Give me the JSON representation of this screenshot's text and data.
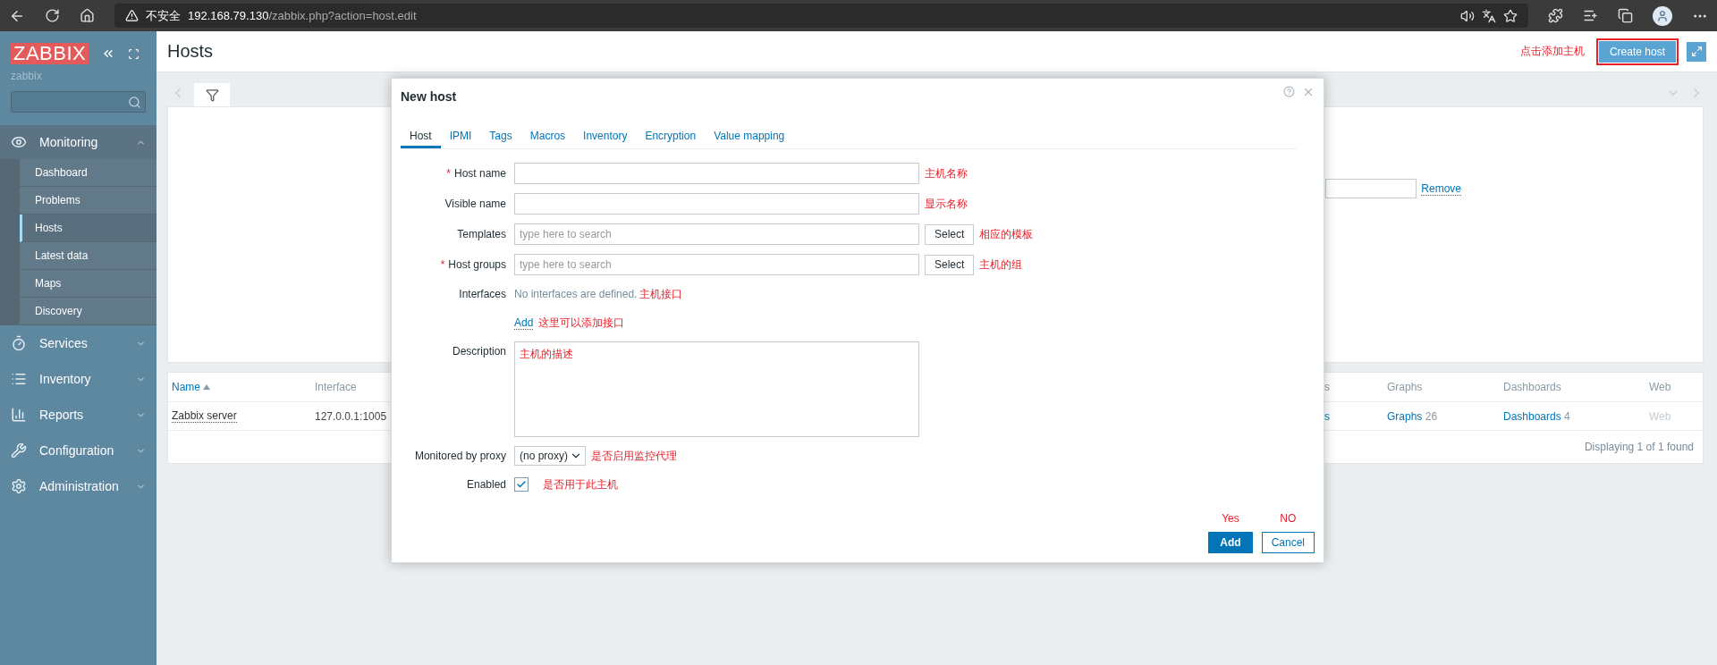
{
  "browser": {
    "security_label": "不安全",
    "url_host": "192.168.79.130",
    "url_path": "/zabbix.php?action=host.edit"
  },
  "sidebar": {
    "logo": "ZABBIX",
    "user": "zabbix",
    "menu": [
      {
        "label": "Monitoring",
        "expanded": true,
        "children": [
          {
            "label": "Dashboard",
            "selected": false
          },
          {
            "label": "Problems",
            "selected": false
          },
          {
            "label": "Hosts",
            "selected": true
          },
          {
            "label": "Latest data",
            "selected": false
          },
          {
            "label": "Maps",
            "selected": false
          },
          {
            "label": "Discovery",
            "selected": false
          }
        ]
      },
      {
        "label": "Services",
        "expanded": false
      },
      {
        "label": "Inventory",
        "expanded": false
      },
      {
        "label": "Reports",
        "expanded": false
      },
      {
        "label": "Configuration",
        "expanded": false
      },
      {
        "label": "Administration",
        "expanded": false
      }
    ]
  },
  "page": {
    "title": "Hosts",
    "annotation": "点击添加主机",
    "create_button": {
      "label": "Create host",
      "highlighted": true
    }
  },
  "filter": {
    "remove_link": "Remove"
  },
  "table": {
    "columns": [
      {
        "label": "Name",
        "sorted": true
      },
      {
        "label": "Interface",
        "sorted": false
      },
      {
        "label": "s",
        "sorted": false
      },
      {
        "label": "Graphs",
        "sorted": false
      },
      {
        "label": "Dashboards",
        "sorted": false
      },
      {
        "label": "Web",
        "sorted": false
      }
    ],
    "rows": [
      {
        "cells": [
          {
            "kind": "host",
            "text": "Zabbix server"
          },
          {
            "kind": "text",
            "text": "127.0.0.1:1005"
          },
          {
            "kind": "link",
            "text": "s"
          },
          {
            "kind": "link",
            "text": "Graphs",
            "count": "26"
          },
          {
            "kind": "link",
            "text": "Dashboards",
            "count": "4"
          },
          {
            "kind": "disabled",
            "text": "Web"
          }
        ]
      }
    ],
    "footer": "Displaying 1 of 1 found"
  },
  "dialog": {
    "title": "New host",
    "required_mark": "*",
    "tabs": [
      {
        "label": "Host",
        "selected": true
      },
      {
        "label": "IPMI",
        "selected": false
      },
      {
        "label": "Tags",
        "selected": false
      },
      {
        "label": "Macros",
        "selected": false
      },
      {
        "label": "Inventory",
        "selected": false
      },
      {
        "label": "Encryption",
        "selected": false
      },
      {
        "label": "Value mapping",
        "selected": false
      }
    ],
    "fields": [
      {
        "kind": "input",
        "label": "Host name",
        "required": true,
        "annotation": "主机名称"
      },
      {
        "kind": "input",
        "label": "Visible name",
        "required": false,
        "annotation": "显示名称"
      },
      {
        "kind": "multiselect",
        "label": "Templates",
        "required": false,
        "placeholder": "type here to search",
        "button": "Select",
        "annotation": "相应的模板"
      },
      {
        "kind": "multiselect",
        "label": "Host groups",
        "required": true,
        "placeholder": "type here to search",
        "button": "Select",
        "annotation": "主机的组"
      },
      {
        "kind": "interfaces",
        "label": "Interfaces",
        "required": false,
        "text": "No interfaces are defined.",
        "annotation": "主机接口",
        "add_link": "Add",
        "add_annotation": "这里可以添加接口"
      },
      {
        "kind": "textarea",
        "label": "Description",
        "required": false,
        "annotation": "主机的描述"
      },
      {
        "kind": "select",
        "label": "Monitored by proxy",
        "required": false,
        "value": "(no proxy)",
        "annotation": "是否启用监控代理"
      },
      {
        "kind": "checkbox",
        "label": "Enabled",
        "required": false,
        "checked": true,
        "annotation": "是否用于此主机"
      }
    ],
    "buttons": [
      {
        "kind": "primary",
        "label": "Add",
        "annotation": "Yes"
      },
      {
        "kind": "secondary",
        "label": "Cancel",
        "annotation": "NO"
      }
    ]
  }
}
